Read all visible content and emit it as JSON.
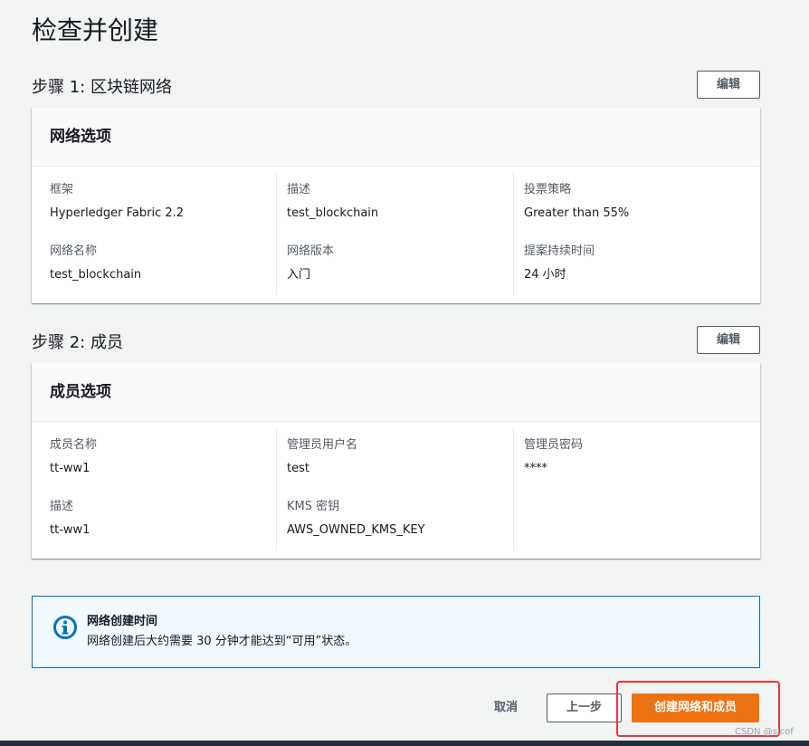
{
  "page": {
    "title": "检查并创建"
  },
  "step1": {
    "header": "步骤 1: 区块链网络",
    "edit_label": "编辑",
    "card_title": "网络选项",
    "fields": {
      "framework": {
        "label": "框架",
        "value": "Hyperledger Fabric 2.2"
      },
      "description": {
        "label": "描述",
        "value": "test_blockchain"
      },
      "voting_policy": {
        "label": "投票策略",
        "value": "Greater than 55%"
      },
      "network_name": {
        "label": "网络名称",
        "value": "test_blockchain"
      },
      "network_edition": {
        "label": "网络版本",
        "value": "入门"
      },
      "proposal_duration": {
        "label": "提案持续时间",
        "value": "24 小时"
      }
    }
  },
  "step2": {
    "header": "步骤 2: 成员",
    "edit_label": "编辑",
    "card_title": "成员选项",
    "fields": {
      "member_name": {
        "label": "成员名称",
        "value": "tt-ww1"
      },
      "admin_username": {
        "label": "管理员用户名",
        "value": "test"
      },
      "admin_password": {
        "label": "管理员密码",
        "value": "****"
      },
      "description": {
        "label": "描述",
        "value": "tt-ww1"
      },
      "kms_key": {
        "label": "KMS 密钥",
        "value": "AWS_OWNED_KMS_KEY"
      }
    }
  },
  "info": {
    "icon": "info-icon",
    "title": "网络创建时间",
    "text": "网络创建后大约需要 30 分钟才能达到“可用”状态。"
  },
  "actions": {
    "cancel_label": "取消",
    "previous_label": "上一步",
    "create_label": "创建网络和成员"
  },
  "watermark": "CSDN @sicof",
  "colors": {
    "primary_button": "#ec7211",
    "info_border": "#0073bb",
    "info_background": "#f1faff",
    "highlight_annotation": "#e5383b",
    "page_background": "#f2f3f3"
  }
}
